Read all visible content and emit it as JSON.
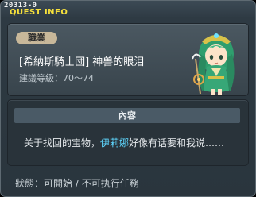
{
  "quest": {
    "id": "20313-0",
    "title": "QUEST INFO",
    "job_badge": "職業",
    "name": "[希納斯騎士団] 神兽的眼泪",
    "level_label": "建議等級",
    "level_range": "70～74",
    "npc_avatar": "npc-portrait-green-hair",
    "content_header": "內容",
    "description_before": "关于找回的宝物，",
    "npc_name": "伊莉娜",
    "description_after": "好像有话要和我说……",
    "status_label": "狀態",
    "status_value": "可開始 / 不可执行任務"
  },
  "colors": {
    "title_yellow": "#f7e13b",
    "npc_name_blue": "#5fd8ff",
    "badge_tan": "#c8b89a"
  }
}
